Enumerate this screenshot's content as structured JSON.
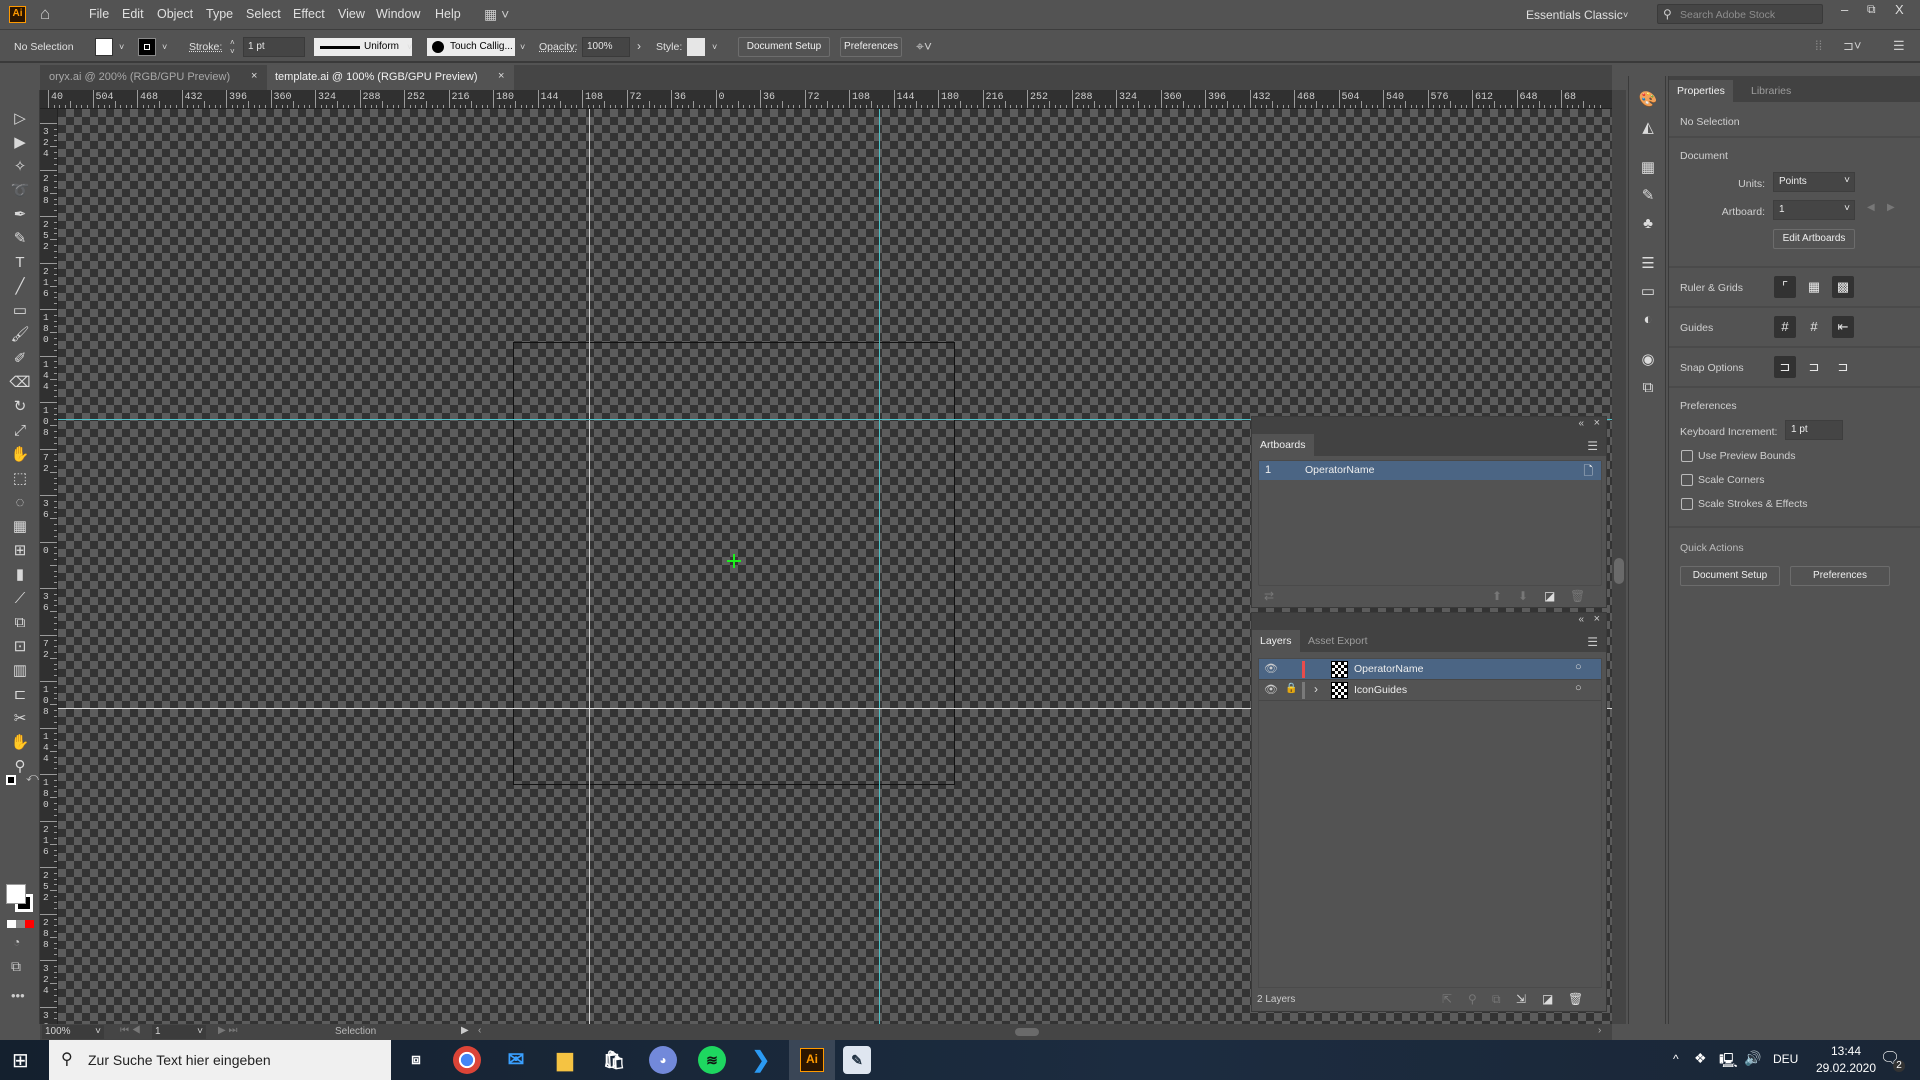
{
  "app": {
    "logo": "Ai"
  },
  "menu": [
    "File",
    "Edit",
    "Object",
    "Type",
    "Select",
    "Effect",
    "View",
    "Window",
    "Help"
  ],
  "workspace": {
    "name": "Essentials Classic",
    "search_placeholder": "Search Adobe Stock"
  },
  "control_bar": {
    "selection": "No Selection",
    "stroke_label": "Stroke:",
    "stroke_value": "1 pt",
    "profile": "Uniform",
    "brush": "Touch Callig...",
    "opacity_label": "Opacity:",
    "opacity_value": "100%",
    "style_label": "Style:",
    "document_setup": "Document Setup",
    "preferences": "Preferences"
  },
  "tabs": [
    {
      "label": "oryx.ai @ 200% (RGB/GPU Preview)",
      "active": false
    },
    {
      "label": "template.ai @ 100% (RGB/GPU Preview)",
      "active": true
    }
  ],
  "ruler_h": [
    "40",
    "504",
    "468",
    "432",
    "396",
    "360",
    "324",
    "288",
    "252",
    "216",
    "180",
    "144",
    "108",
    "72",
    "36",
    "0",
    "36",
    "72",
    "108",
    "144",
    "180",
    "216",
    "252",
    "288",
    "324",
    "360",
    "396",
    "432",
    "468",
    "504",
    "540",
    "576",
    "612",
    "648",
    "68"
  ],
  "ruler_v": [
    "324",
    "288",
    "252",
    "216",
    "180",
    "144",
    "108",
    "72",
    "36",
    "0",
    "36",
    "72",
    "108",
    "144",
    "180",
    "216",
    "252",
    "288",
    "324",
    "360"
  ],
  "tools": [
    "selection-tool",
    "direct-selection-tool",
    "magic-wand-tool",
    "lasso-tool",
    "pen-tool",
    "curvature-tool",
    "type-tool",
    "line-tool",
    "rectangle-tool",
    "paintbrush-tool",
    "shaper-tool",
    "eraser-tool",
    "rotate-tool",
    "scale-tool",
    "puppet-warp-tool",
    "free-transform-tool",
    "shape-builder-tool",
    "perspective-grid-tool",
    "mesh-tool",
    "gradient-tool",
    "eyedropper-tool",
    "blend-tool",
    "symbol-sprayer-tool",
    "column-graph-tool",
    "artboard-tool",
    "slice-tool",
    "hand-tool",
    "zoom-tool"
  ],
  "tool_glyphs": [
    "▷",
    "▶",
    "✧",
    "➰",
    "✒",
    "✎",
    "T",
    "╱",
    "▭",
    "🖌",
    "✐",
    "⌫",
    "↻",
    "⤢",
    "✋",
    "⬚",
    "◌",
    "▦",
    "⊞",
    "▮",
    "⟋",
    "⧉",
    "⊡",
    "▥",
    "⊏",
    "✂",
    "✋",
    "⚲"
  ],
  "artboards_panel": {
    "title": "Artboards",
    "rows": [
      {
        "index": "1",
        "name": "OperatorName"
      }
    ]
  },
  "layers_panel": {
    "tabs": [
      "Layers",
      "Asset Export"
    ],
    "layers": [
      {
        "name": "OperatorName",
        "visible": true,
        "locked": false,
        "color": "#e84c4c"
      },
      {
        "name": "IconGuides",
        "visible": true,
        "locked": true,
        "color": "#7a7a7a"
      }
    ],
    "count": "2 Layers"
  },
  "properties": {
    "tabs": [
      "Properties",
      "Libraries"
    ],
    "selection": "No Selection",
    "document_heading": "Document",
    "units_label": "Units:",
    "units_value": "Points",
    "artboard_label": "Artboard:",
    "artboard_value": "1",
    "edit_artboards": "Edit Artboards",
    "ruler_grids": "Ruler & Grids",
    "guides": "Guides",
    "snap_options": "Snap Options",
    "preferences_heading": "Preferences",
    "keyboard_increment_label": "Keyboard Increment:",
    "keyboard_increment_value": "1 pt",
    "checkboxes": [
      {
        "label": "Use Preview Bounds",
        "checked": false
      },
      {
        "label": "Scale Corners",
        "checked": false
      },
      {
        "label": "Scale Strokes & Effects",
        "checked": false
      }
    ],
    "quick_actions": "Quick Actions",
    "qa_document_setup": "Document Setup",
    "qa_preferences": "Preferences"
  },
  "status_bar": {
    "zoom": "100%",
    "artboard": "1",
    "tool": "Selection"
  },
  "taskbar": {
    "search_placeholder": "Zur Suche Text hier eingeben",
    "language": "DEU",
    "time": "13:44",
    "date": "29.02.2020",
    "notifications": "2"
  },
  "colors": {
    "guide_cyan": "#4fc3c9",
    "accent_selection": "#4b6584",
    "illustrator_orange": "#ff9a00"
  }
}
